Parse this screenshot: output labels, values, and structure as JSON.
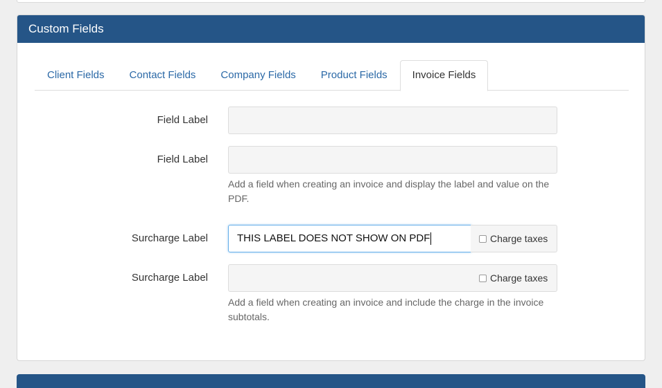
{
  "panel": {
    "title": "Custom Fields"
  },
  "tabs": [
    {
      "label": "Client Fields",
      "active": false
    },
    {
      "label": "Contact Fields",
      "active": false
    },
    {
      "label": "Company Fields",
      "active": false
    },
    {
      "label": "Product Fields",
      "active": false
    },
    {
      "label": "Invoice Fields",
      "active": true
    }
  ],
  "invoice_fields": {
    "field1": {
      "label": "Field Label",
      "value": ""
    },
    "field2": {
      "label": "Field Label",
      "value": ""
    },
    "field_help": "Add a field when creating an invoice and display the label and value on the PDF.",
    "surcharge1": {
      "label": "Surcharge Label",
      "value": "THIS LABEL DOES NOT SHOW ON PDF",
      "charge_taxes_label": "Charge taxes",
      "charge_taxes": false
    },
    "surcharge2": {
      "label": "Surcharge Label",
      "value": "",
      "charge_taxes_label": "Charge taxes",
      "charge_taxes": false
    },
    "surcharge_help": "Add a field when creating an invoice and include the charge in the invoice subtotals."
  },
  "colors": {
    "heading_bg": "#255587",
    "link": "#2a68a6",
    "focus_border": "#66afe9"
  }
}
